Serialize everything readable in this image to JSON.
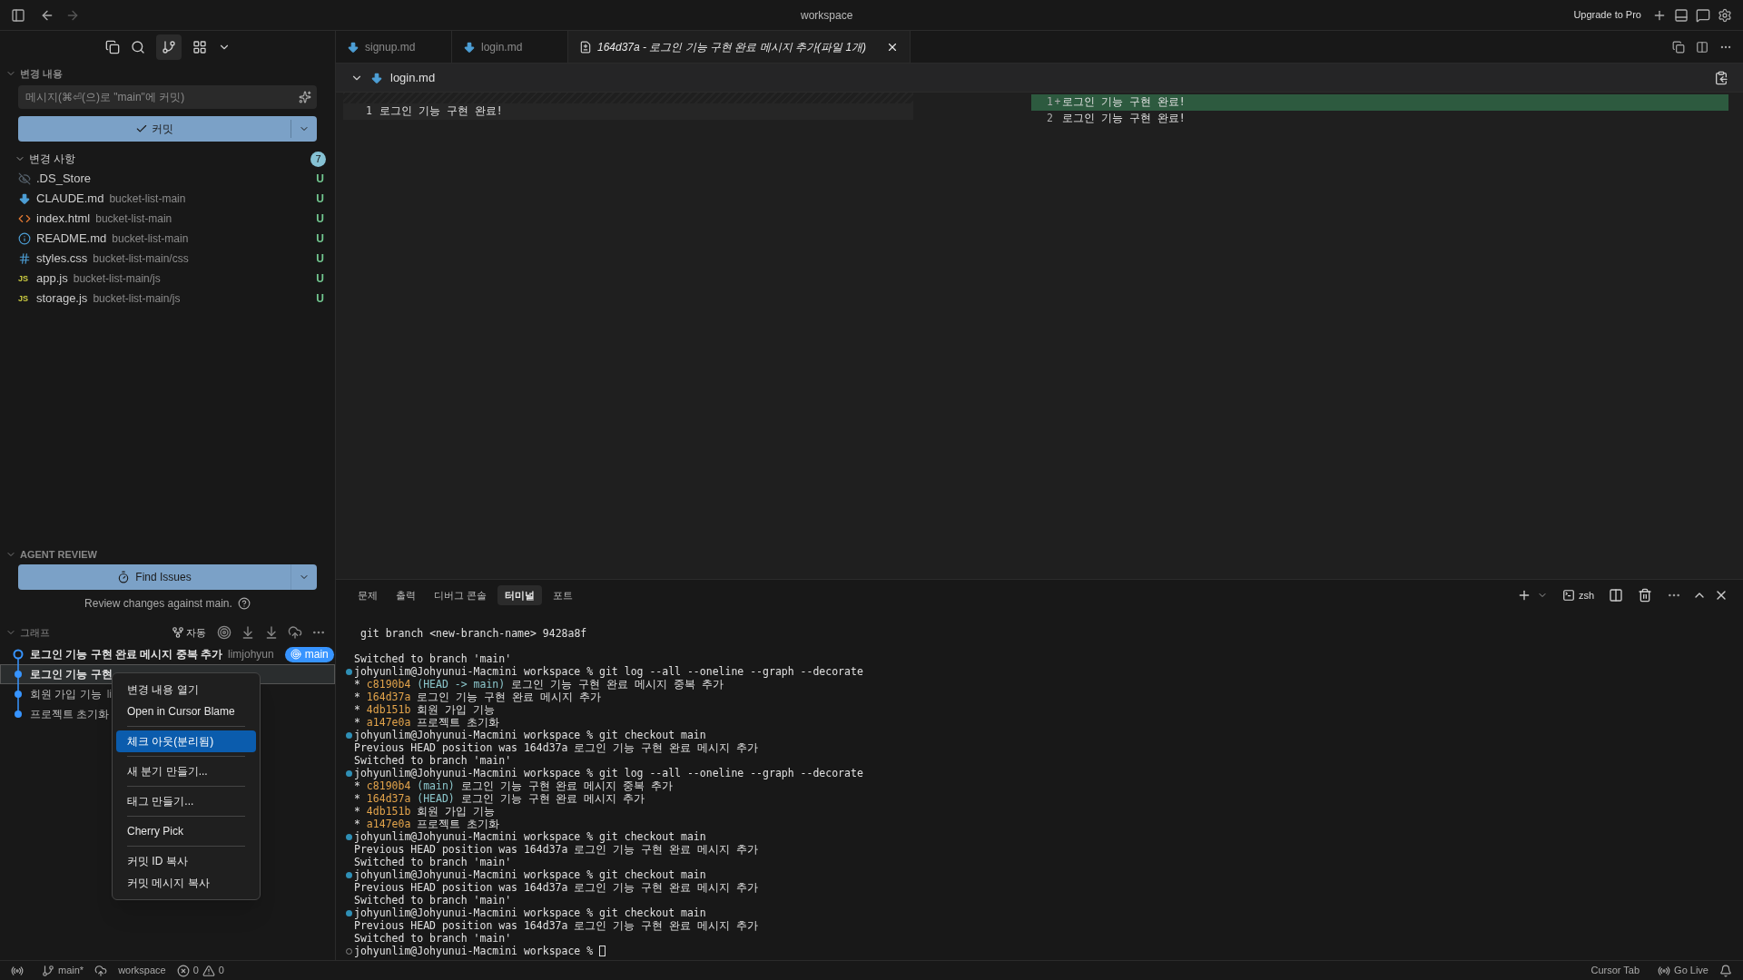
{
  "title_bar": {
    "title": "workspace",
    "upgrade": "Upgrade to Pro"
  },
  "sidebar": {
    "changes_section": {
      "title": "변경 내용",
      "placeholder": "메시지(⌘⏎(으)로 \"main\"에 커밋)",
      "commit_button": "커밋"
    },
    "changes": {
      "title": "변경 사항",
      "count": "7",
      "files": [
        {
          "name": ".DS_Store",
          "status": "U",
          "kind": "ignored"
        },
        {
          "name": "CLAUDE.md",
          "path": "bucket-list-main",
          "status": "U",
          "kind": "markdown"
        },
        {
          "name": "index.html",
          "path": "bucket-list-main",
          "status": "U",
          "kind": "html"
        },
        {
          "name": "README.md",
          "path": "bucket-list-main",
          "status": "U",
          "kind": "info"
        },
        {
          "name": "styles.css",
          "path": "bucket-list-main/css",
          "status": "U",
          "kind": "css"
        },
        {
          "name": "app.js",
          "path": "bucket-list-main/js",
          "status": "U",
          "kind": "js",
          "badge": "JS"
        },
        {
          "name": "storage.js",
          "path": "bucket-list-main/js",
          "status": "U",
          "kind": "js",
          "badge": "JS"
        }
      ]
    },
    "agent_review": {
      "title": "AGENT REVIEW",
      "button": "Find Issues",
      "note": "Review changes against main."
    },
    "graph": {
      "title": "그래프",
      "auto": "자동",
      "commits": [
        {
          "message": "로그인 기능 구현 완료 메시지 중복 추가",
          "author": "limjohyun",
          "branch": "main",
          "head": true,
          "selected": false
        },
        {
          "message": "로그인 기능 구현",
          "head": false,
          "selected": true
        },
        {
          "message": "회원 가입 기능",
          "author": "li",
          "head": false,
          "selected": false
        },
        {
          "message": "프로젝트 초기화",
          "head": false,
          "selected": false
        }
      ]
    }
  },
  "context_menu": {
    "groups": [
      [
        {
          "label": "변경 내용 열기",
          "selected": false
        },
        {
          "label": "Open in Cursor Blame",
          "selected": false
        }
      ],
      [
        {
          "label": "체크 아웃(분리됨)",
          "selected": true
        }
      ],
      [
        {
          "label": "새 분기 만들기...",
          "selected": false
        }
      ],
      [
        {
          "label": "태그 만들기...",
          "selected": false
        }
      ],
      [
        {
          "label": "Cherry Pick",
          "selected": false
        }
      ],
      [
        {
          "label": "커밋 ID 복사",
          "selected": false
        },
        {
          "label": "커밋 메시지 복사",
          "selected": false
        }
      ]
    ]
  },
  "editor": {
    "tabs": [
      {
        "label": "signup.md",
        "kind": "markdown",
        "selected": false
      },
      {
        "label": "login.md",
        "kind": "markdown",
        "selected": false
      },
      {
        "label": "164d37a - 로그인 기능 구현 완료 메시지 추가(파일 1개)",
        "kind": "diff",
        "selected": true
      }
    ],
    "diff": {
      "file": "login.md",
      "left": [
        {
          "number": "1",
          "text": "로그인 기능 구현 완료!",
          "kind": "normal"
        }
      ],
      "right": [
        {
          "number": "1",
          "sign": "+",
          "text": "로그인 기능 구현 완료!",
          "kind": "added"
        },
        {
          "number": "2",
          "text": "로그인 기능 구현 완료!",
          "kind": "normal"
        }
      ]
    }
  },
  "panel": {
    "tabs": [
      {
        "label": "문제",
        "selected": false
      },
      {
        "label": "출력",
        "selected": false
      },
      {
        "label": "디버그 콘솔",
        "selected": false
      },
      {
        "label": "터미널",
        "selected": true
      },
      {
        "label": "포트",
        "selected": false
      }
    ],
    "shell": "zsh",
    "lines": [
      {
        "kind": "indented",
        "segments": [
          {
            "text": "git branch <new-branch-name> 9428a8f",
            "kind": "plain"
          }
        ]
      },
      {
        "kind": "blank"
      },
      {
        "kind": "output",
        "segments": [
          {
            "text": "Switched to branch 'main'",
            "kind": "plain"
          }
        ]
      },
      {
        "kind": "prompt",
        "done": true,
        "segments": [
          {
            "text": "johyunlim@Johyunui-Macmini workspace % git log --all --oneline --graph --decorate",
            "kind": "plain"
          }
        ]
      },
      {
        "kind": "output",
        "segments": [
          {
            "text": "* ",
            "kind": "plain"
          },
          {
            "text": "c8190b4",
            "kind": "hash"
          },
          {
            "text": " (HEAD -> main)",
            "kind": "ref"
          },
          {
            "text": " 로그인 기능 구현 완료 메시지 중복 추가",
            "kind": "plain"
          }
        ]
      },
      {
        "kind": "output",
        "segments": [
          {
            "text": "* ",
            "kind": "plain"
          },
          {
            "text": "164d37a",
            "kind": "hash"
          },
          {
            "text": " 로그인 기능 구현 완료 메시지 추가",
            "kind": "plain"
          }
        ]
      },
      {
        "kind": "output",
        "segments": [
          {
            "text": "* ",
            "kind": "plain"
          },
          {
            "text": "4db151b",
            "kind": "hash"
          },
          {
            "text": " 회원 가입 기능",
            "kind": "plain"
          }
        ]
      },
      {
        "kind": "output",
        "segments": [
          {
            "text": "* ",
            "kind": "plain"
          },
          {
            "text": "a147e0a",
            "kind": "hash"
          },
          {
            "text": " 프로젝트 초기화",
            "kind": "plain"
          }
        ]
      },
      {
        "kind": "prompt",
        "done": true,
        "segments": [
          {
            "text": "johyunlim@Johyunui-Macmini workspace % git checkout main",
            "kind": "plain"
          }
        ]
      },
      {
        "kind": "output",
        "segments": [
          {
            "text": "Previous HEAD position was 164d37a 로그인 기능 구현 완료 메시지 추가",
            "kind": "plain"
          }
        ]
      },
      {
        "kind": "output",
        "segments": [
          {
            "text": "Switched to branch 'main'",
            "kind": "plain"
          }
        ]
      },
      {
        "kind": "prompt",
        "done": true,
        "segments": [
          {
            "text": "johyunlim@Johyunui-Macmini workspace % git log --all --oneline --graph --decorate",
            "kind": "plain"
          }
        ]
      },
      {
        "kind": "output",
        "segments": [
          {
            "text": "* ",
            "kind": "plain"
          },
          {
            "text": "c8190b4",
            "kind": "hash"
          },
          {
            "text": " (main)",
            "kind": "ref"
          },
          {
            "text": " 로그인 기능 구현 완료 메시지 중복 추가",
            "kind": "plain"
          }
        ]
      },
      {
        "kind": "output",
        "segments": [
          {
            "text": "* ",
            "kind": "plain"
          },
          {
            "text": "164d37a",
            "kind": "hash"
          },
          {
            "text": " (HEAD)",
            "kind": "ref"
          },
          {
            "text": " 로그인 기능 구현 완료 메시지 추가",
            "kind": "plain"
          }
        ]
      },
      {
        "kind": "output",
        "segments": [
          {
            "text": "* ",
            "kind": "plain"
          },
          {
            "text": "4db151b",
            "kind": "hash"
          },
          {
            "text": " 회원 가입 기능",
            "kind": "plain"
          }
        ]
      },
      {
        "kind": "output",
        "segments": [
          {
            "text": "* ",
            "kind": "plain"
          },
          {
            "text": "a147e0a",
            "kind": "hash"
          },
          {
            "text": " 프로젝트 초기화",
            "kind": "plain"
          }
        ]
      },
      {
        "kind": "prompt",
        "done": true,
        "segments": [
          {
            "text": "johyunlim@Johyunui-Macmini workspace % git checkout main",
            "kind": "plain"
          }
        ]
      },
      {
        "kind": "output",
        "segments": [
          {
            "text": "Previous HEAD position was 164d37a 로그인 기능 구현 완료 메시지 추가",
            "kind": "plain"
          }
        ]
      },
      {
        "kind": "output",
        "segments": [
          {
            "text": "Switched to branch 'main'",
            "kind": "plain"
          }
        ]
      },
      {
        "kind": "prompt",
        "done": true,
        "segments": [
          {
            "text": "johyunlim@Johyunui-Macmini workspace % git checkout main",
            "kind": "plain"
          }
        ]
      },
      {
        "kind": "output",
        "segments": [
          {
            "text": "Previous HEAD position was 164d37a 로그인 기능 구현 완료 메시지 추가",
            "kind": "plain"
          }
        ]
      },
      {
        "kind": "output",
        "segments": [
          {
            "text": "Switched to branch 'main'",
            "kind": "plain"
          }
        ]
      },
      {
        "kind": "prompt",
        "done": true,
        "segments": [
          {
            "text": "johyunlim@Johyunui-Macmini workspace % git checkout main",
            "kind": "plain"
          }
        ]
      },
      {
        "kind": "output",
        "segments": [
          {
            "text": "Previous HEAD position was 164d37a 로그인 기능 구현 완료 메시지 추가",
            "kind": "plain"
          }
        ]
      },
      {
        "kind": "output",
        "segments": [
          {
            "text": "Switched to branch 'main'",
            "kind": "plain"
          }
        ]
      },
      {
        "kind": "prompt",
        "done": false,
        "cursor": true,
        "segments": [
          {
            "text": "johyunlim@Johyunui-Macmini workspace %",
            "kind": "plain"
          }
        ]
      }
    ]
  },
  "status_bar": {
    "branch": "main*",
    "workspace": "workspace",
    "errors": "0",
    "warnings": "0",
    "cursor_tab": "Cursor Tab",
    "go_live": "Go Live"
  }
}
